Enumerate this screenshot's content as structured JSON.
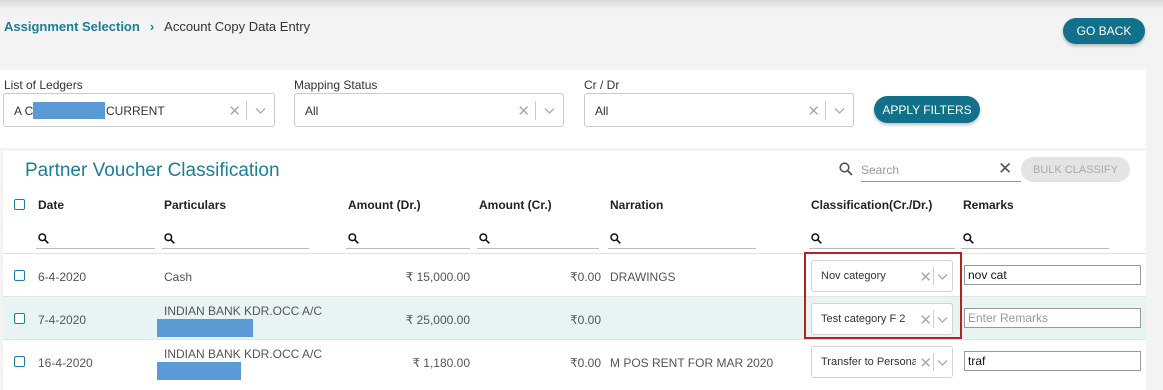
{
  "breadcrumb": {
    "link": "Assignment Selection",
    "separator": "›",
    "current": "Account Copy Data Entry"
  },
  "go_back_label": "GO BACK",
  "filters": {
    "ledgers_label": "List of Ledgers",
    "ledgers_value_prefix": "A C",
    "ledgers_value_suffix": "CURRENT",
    "mapping_label": "Mapping Status",
    "mapping_value": "All",
    "crdr_label": "Cr / Dr",
    "crdr_value": "All",
    "apply_label": "APPLY FILTERS",
    "clear_glyph": "✕"
  },
  "panel": {
    "title": "Partner Voucher Classification",
    "search_placeholder": "Search",
    "search_clear": "✕",
    "bulk_label": "BULK CLASSIFY"
  },
  "columns": [
    "Date",
    "Particulars",
    "Amount (Dr.)",
    "Amount (Cr.)",
    "Narration",
    "Classification(Cr./Dr.)",
    "Remarks"
  ],
  "rows": [
    {
      "date": "6-4-2020",
      "particulars": "Cash",
      "dr": "₹ 15,000.00",
      "cr": "₹0.00",
      "narration": "DRAWINGS",
      "classification": "Nov category",
      "remarks": "nov cat",
      "remarks_placeholder": ""
    },
    {
      "date": "7-4-2020",
      "particulars": "INDIAN BANK KDR.OCC A/C",
      "dr": "₹ 25,000.00",
      "cr": "₹0.00",
      "narration": "",
      "classification": "Test category F 2",
      "remarks": "",
      "remarks_placeholder": "Enter Remarks"
    },
    {
      "date": "16-4-2020",
      "particulars": "INDIAN BANK KDR.OCC A/C",
      "dr": "₹ 1,180.00",
      "cr": "₹0.00",
      "narration": "M POS RENT FOR MAR 2020",
      "classification": "Transfer to Personal ...",
      "remarks": "traf",
      "remarks_placeholder": ""
    }
  ],
  "colors": {
    "accent": "#11718b",
    "link": "#1a7f98",
    "highlight": "#b22222",
    "redaction": "#5b9bd5"
  },
  "icons": {
    "search": "search-icon",
    "clear": "close-icon",
    "dropdown": "chevron-down-icon"
  }
}
